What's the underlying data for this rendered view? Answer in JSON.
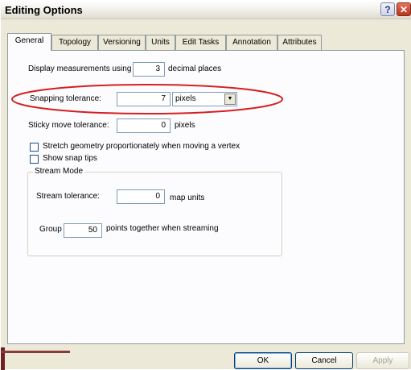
{
  "window": {
    "title": "Editing Options",
    "help_label": "?",
    "close_label": "✕"
  },
  "tabs": [
    {
      "label": "General",
      "active": true
    },
    {
      "label": "Topology"
    },
    {
      "label": "Versioning"
    },
    {
      "label": "Units"
    },
    {
      "label": "Edit Tasks"
    },
    {
      "label": "Annotation"
    },
    {
      "label": "Attributes"
    }
  ],
  "general": {
    "display_measurements_label": "Display measurements using",
    "decimal_places_value": "3",
    "decimal_places_label": "decimal places",
    "snapping_tolerance_label": "Snapping tolerance:",
    "snapping_tolerance_value": "7",
    "snapping_units_selected": "pixels",
    "sticky_move_label": "Sticky move tolerance:",
    "sticky_move_value": "0",
    "sticky_move_units": "pixels",
    "stretch_geometry_label": "Stretch geometry proportionately when moving a vertex",
    "stretch_geometry_checked": false,
    "show_snap_tips_label": "Show snap tips",
    "show_snap_tips_checked": false
  },
  "stream_mode": {
    "legend": "Stream Mode",
    "stream_tolerance_label": "Stream tolerance:",
    "stream_tolerance_value": "0",
    "stream_tolerance_units": "map units",
    "group_label": "Group",
    "group_value": "50",
    "group_suffix": "points together when streaming"
  },
  "buttons": {
    "ok": "OK",
    "cancel": "Cancel",
    "apply": "Apply"
  },
  "annotation": {
    "highlight_color": "#d42020"
  }
}
